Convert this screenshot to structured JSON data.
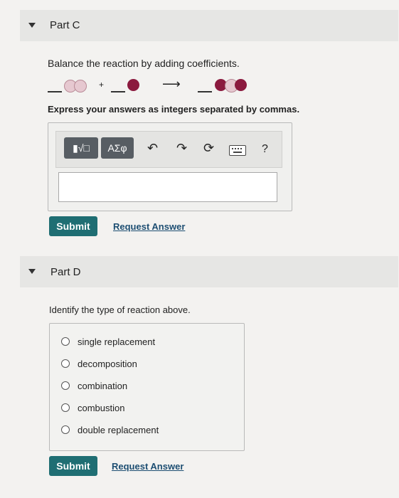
{
  "part_c": {
    "title": "Part C",
    "instruction": "Balance the reaction by adding coefficients.",
    "plus": "+",
    "arrow": "⟶",
    "prompt": "Express your answers as integers separated by commas.",
    "toolbar": {
      "templates_label": "▮√□",
      "greek_label": "ΑΣφ",
      "help_label": "?"
    },
    "answer_value": "",
    "submit_label": "Submit",
    "request_label": "Request Answer"
  },
  "part_d": {
    "title": "Part D",
    "question": "Identify the type of reaction above.",
    "options": [
      "single replacement",
      "decomposition",
      "combination",
      "combustion",
      "double replacement"
    ],
    "submit_label": "Submit",
    "request_label": "Request Answer"
  },
  "colors": {
    "submit_bg": "#1f6e73",
    "link": "#1d4e72",
    "molecule_dark": "#8b1a3e",
    "molecule_light": "#e6c8d0"
  },
  "icons": [
    "caret-down-icon",
    "undo-icon",
    "redo-icon",
    "reset-icon",
    "keyboard-icon",
    "help-icon"
  ]
}
